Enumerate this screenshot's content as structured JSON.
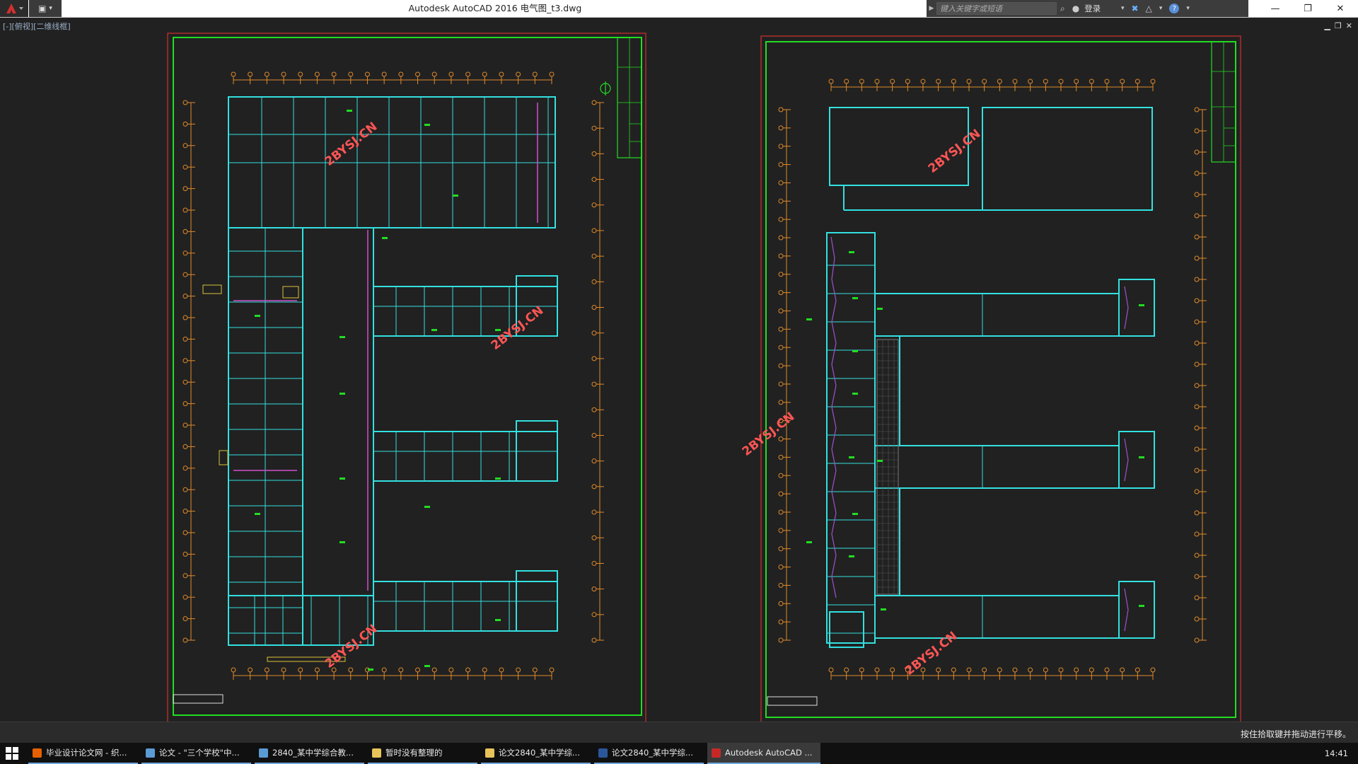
{
  "window": {
    "title": "Autodesk AutoCAD 2016    电气图_t3.dwg",
    "search_placeholder": "键入关键字或短语",
    "login_label": "登录",
    "minimize_glyph": "—",
    "maximize_glyph": "❐",
    "close_glyph": "✕"
  },
  "viewport": {
    "label": "[-][俯视][二维线框]"
  },
  "watermarks": [
    "2BYSJ.CN",
    "2BYSJ.CN",
    "2BYSJ.CN",
    "2BYSJ.CN",
    "2BYSJ.CN",
    "2BYSJ.CN"
  ],
  "status": {
    "message": "按住拾取键并拖动进行平移。"
  },
  "taskbar": {
    "items": [
      {
        "label": "毕业设计论文网 - 织...",
        "icon": "firefox-icon",
        "color": "#e66000"
      },
      {
        "label": "论文 - \"三个学校\"中...",
        "icon": "notepad-icon",
        "color": "#5b9bd5"
      },
      {
        "label": "2840_某中学综合教...",
        "icon": "word-icon",
        "color": "#5b9bd5"
      },
      {
        "label": "暂时没有整理的",
        "icon": "folder-icon",
        "color": "#e8c35a"
      },
      {
        "label": "论文2840_某中学综...",
        "icon": "folder-icon",
        "color": "#e8c35a"
      },
      {
        "label": "论文2840_某中学综...",
        "icon": "word-icon",
        "color": "#2b579a"
      },
      {
        "label": "Autodesk AutoCAD ...",
        "icon": "autocad-icon",
        "color": "#c62828"
      }
    ],
    "clock": "14:41"
  },
  "colors": {
    "background": "#212121",
    "frame_red": "#d32f2f",
    "frame_green": "#22dd22",
    "wall_cyan": "#33e0e0",
    "axis_orange": "#e08a2a",
    "watermark": "#ff5555"
  }
}
